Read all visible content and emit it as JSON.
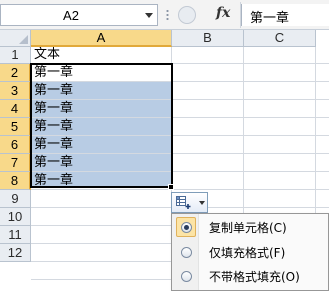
{
  "formula_bar": {
    "name_box": "A2",
    "fx_label": "fx",
    "formula_value": "第一章"
  },
  "columns": [
    "A",
    "B",
    "C"
  ],
  "rows": [
    "1",
    "2",
    "3",
    "4",
    "5",
    "6",
    "7",
    "8",
    "9",
    "10",
    "11",
    "12"
  ],
  "cells": {
    "A1": "文本",
    "A2": "第一章",
    "A3": "第一章",
    "A4": "第一章",
    "A5": "第一章",
    "A6": "第一章",
    "A7": "第一章",
    "A8": "第一章"
  },
  "autofill_menu": {
    "items": [
      {
        "label": "复制单元格(C)",
        "selected": true
      },
      {
        "label": "仅填充格式(F)",
        "selected": false
      },
      {
        "label": "不带格式填充(O)",
        "selected": false
      }
    ]
  },
  "colors": {
    "selection_fill": "#b8cce4",
    "header_selected": "#f8d98a",
    "menu_highlight": "#fce4a6"
  }
}
